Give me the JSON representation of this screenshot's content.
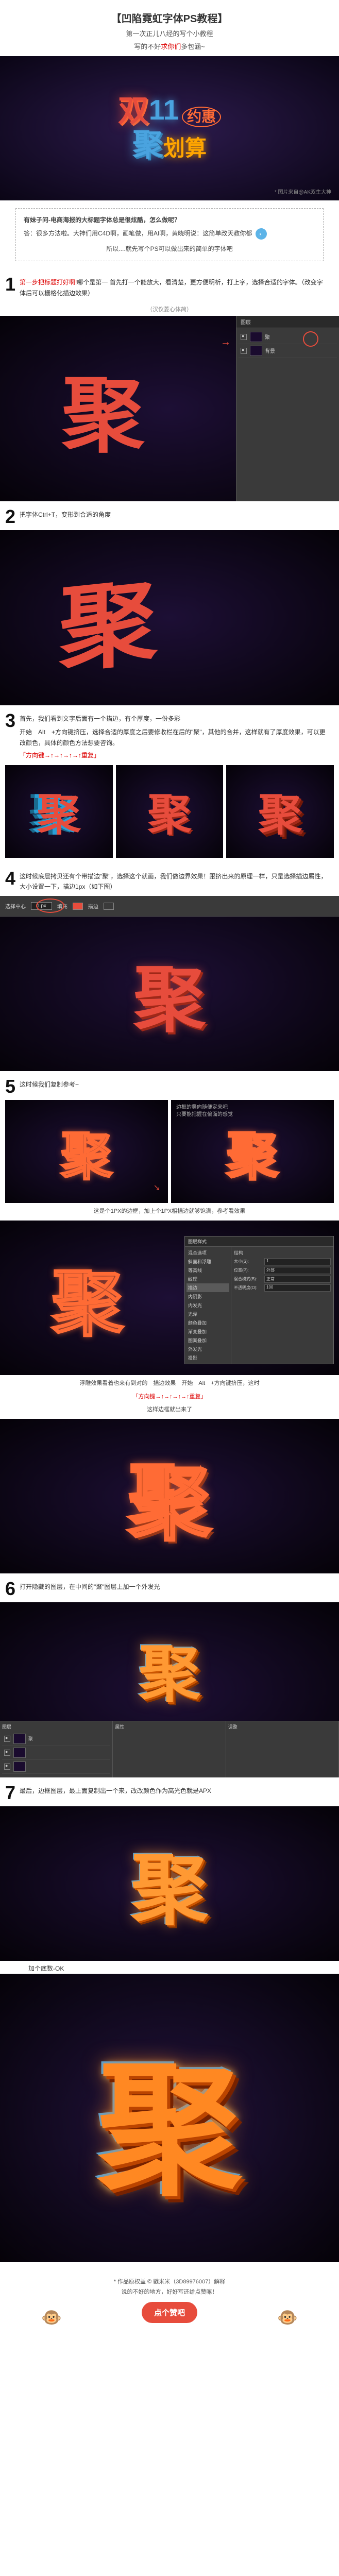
{
  "header": {
    "title": "【凹陷霓虹字体PS教程】",
    "subtitle_1": "第一次正儿八经的写个小教程",
    "subtitle_2a": "写的不好",
    "subtitle_2b": "求你们",
    "subtitle_2c": "多包涵~"
  },
  "hero": {
    "shuang": "双",
    "num": "11",
    "yuehui": "约惠",
    "ju": "聚",
    "huasuan": "划算",
    "credit": "* 图片来自@AK双生大神"
  },
  "callout": {
    "q": "有妹子问-电商海报的大标题字体总是很炫酷，怎么做呢？",
    "a": "答：很多方法啦。大神们用C4D啊，画笔做，用AI啊，黄晓明说：这简单改天教你都",
    "avatar_alt": "face-icon",
    "conclusion": "所以....就先写个PS可以做出来的简单的字体吧"
  },
  "step1": {
    "num": "1",
    "red_text": "第一步把标题打好啊!",
    "text": "哪个是第一 首先打一个能放大，看清楚，更方便明析，打上字，选择合适的字体。（改变字体后可以栅格化描边效果）",
    "note": "（汉仪菱心体简）",
    "char": "聚",
    "layers_title": "图层",
    "layers": [
      "聚",
      "背景"
    ]
  },
  "step2": {
    "num": "2",
    "text": "把字体Ctrl+T，变形到合适的角度",
    "char": "聚"
  },
  "step3": {
    "num": "3",
    "text_1": "首先，我们看到文字后面有一个描边，有个厚度，一份多彩",
    "text_2": "开始　Alt　+方向键挤压，选择合适的厚度之后要修收栏在后的\"聚\"，其他的合并，这样就有了厚度效果，可以更改颜色，具体的颜色方法想要咨询。",
    "direction": "「方向键→↑→↑→↑→↑重复」",
    "char": "聚"
  },
  "step4": {
    "num": "4",
    "text": "这时候底层拷贝还有个带描边\"聚\"，选择这个就画，我们做边界效果！跟挤出来的原理一样，只是选择描边属性，大小设置一下，描边1px（如下图）",
    "toolbar_items": [
      "选择中心",
      "1 px",
      "填充",
      "描边"
    ],
    "char": "聚"
  },
  "step5": {
    "num": "5",
    "text": "这时候我们复制参考~",
    "char": "聚",
    "caption_top1": "边框的竖向随便定来吧",
    "caption_top2": "只要能把握在偏面的感觉",
    "caption_mid": "这是个1PX的边框，加上个1PX相描边就够饱满，参考看效果",
    "dialog_title": "图层样式",
    "dialog_styles": [
      "混合选项",
      "斜面和浮雕",
      "等高线",
      "纹理",
      "描边",
      "内阴影",
      "内发光",
      "光泽",
      "颜色叠加",
      "渐变叠加",
      "图案叠加",
      "外发光",
      "投影"
    ],
    "dialog_right": {
      "struct": "结构",
      "size_lbl": "大小(S):",
      "size_val": "1",
      "pos_lbl": "位置(P):",
      "pos_val": "外部",
      "blend_lbl": "混合模式(B):",
      "blend_val": "正常",
      "opacity_lbl": "不透明度(O):",
      "opacity_val": "100"
    },
    "caption_bottom1": "浮雕效果看着也来有到对的　描边效果　开始　Alt　+方向键挤压，这时",
    "direction": "「方向键→↑→↑→↑→↑重复」",
    "caption_bottom2": "这样边框就出来了"
  },
  "step6": {
    "num": "6",
    "text": "打开隐藏的图层，在中间的\"聚\"图层上加一个外发光",
    "char": "聚",
    "panes": [
      "图层",
      "属性",
      "调整"
    ]
  },
  "step7": {
    "num": "7",
    "text": "最后，边框图层，最上面复制出一个来，改改颜色作为高光色就是APX",
    "note": "加个底数-OK",
    "char": "聚"
  },
  "footer": {
    "credit1": "* 作品原权益 © 戳米米（3D89976007）解释",
    "credit2": "说的不好的地方，好好写还给点赞嘛！",
    "like": "点个赞吧"
  }
}
